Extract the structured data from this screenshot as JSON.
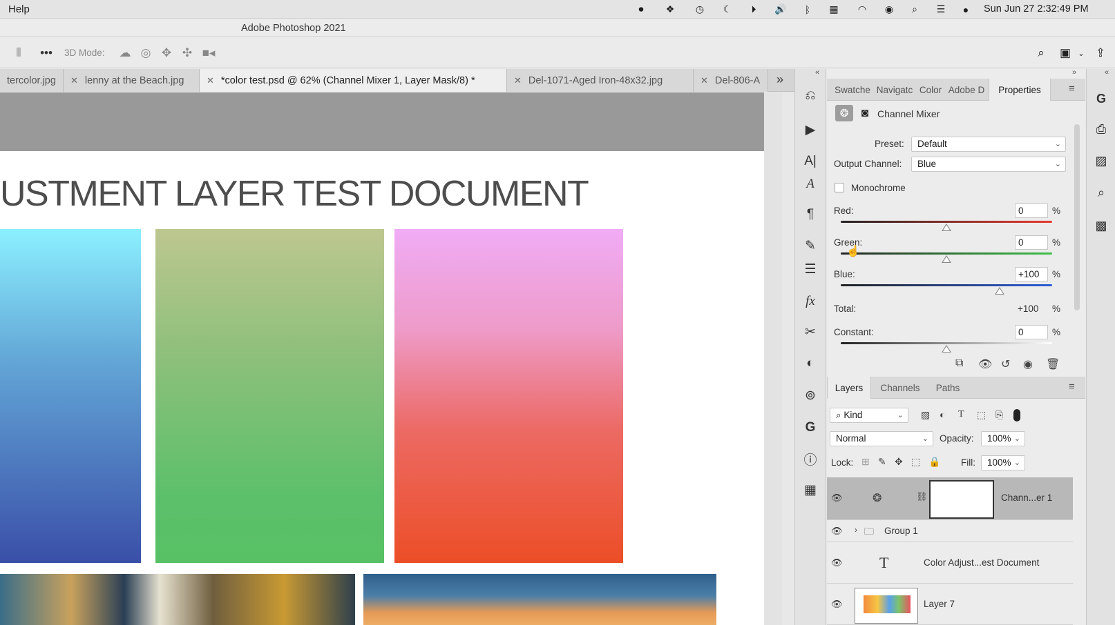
{
  "menubar": {
    "help_label": "Help",
    "clock": "Sun Jun 27  2:32:49 PM",
    "status_icons": [
      "record-icon",
      "dropbox-icon",
      "time-machine-icon",
      "moon-icon",
      "play-icon",
      "volume-icon",
      "bluetooth-icon",
      "calendar-icon",
      "wifi-icon",
      "user-icon",
      "search-icon",
      "control-center-icon",
      "siri-icon"
    ]
  },
  "window": {
    "title": "Adobe Photoshop 2021"
  },
  "options_bar": {
    "mode_label": "3D Mode:"
  },
  "tabs": [
    {
      "label": "tercolor.jpg",
      "closable": false,
      "active": false
    },
    {
      "label": "lenny at the Beach.jpg",
      "closable": true,
      "active": false
    },
    {
      "label": "*color test.psd @ 62% (Channel Mixer 1, Layer Mask/8) *",
      "closable": true,
      "active": true
    },
    {
      "label": "Del-1071-Aged Iron-48x32.jpg",
      "closable": true,
      "active": false
    },
    {
      "label": "Del-806-A",
      "closable": true,
      "active": false
    }
  ],
  "tabs_overflow": "»",
  "document": {
    "heading": "USTMENT LAYER TEST DOCUMENT"
  },
  "panel_tabs": [
    "Swatche",
    "Navigatc",
    "Color",
    "Adobe D",
    "Properties"
  ],
  "properties": {
    "title": "Channel Mixer",
    "preset_label": "Preset:",
    "preset_value": "Default",
    "output_label": "Output Channel:",
    "output_value": "Blue",
    "monochrome_label": "Monochrome",
    "monochrome_checked": false,
    "red_label": "Red:",
    "red_value": "0",
    "green_label": "Green:",
    "green_value": "0",
    "blue_label": "Blue:",
    "blue_value": "+100",
    "total_label": "Total:",
    "total_value": "+100",
    "constant_label": "Constant:",
    "constant_value": "0",
    "percent": "%",
    "slider_levels": {
      "red": 0,
      "green": 0,
      "blue": 100,
      "constant": 0
    }
  },
  "layers_tabs": [
    "Layers",
    "Channels",
    "Paths"
  ],
  "layers": {
    "filter_kind": "Kind",
    "blend_mode": "Normal",
    "opacity_label": "Opacity:",
    "opacity_value": "100%",
    "lock_label": "Lock:",
    "fill_label": "Fill:",
    "fill_value": "100%",
    "rows": [
      {
        "name": "Chann...er 1"
      },
      {
        "name": "Group 1"
      },
      {
        "name": "Color Adjust...est Document"
      },
      {
        "name": "Layer 7"
      }
    ]
  },
  "colors": {
    "accent_blue": "#2b5cd8",
    "panel_bg": "#ececec"
  }
}
